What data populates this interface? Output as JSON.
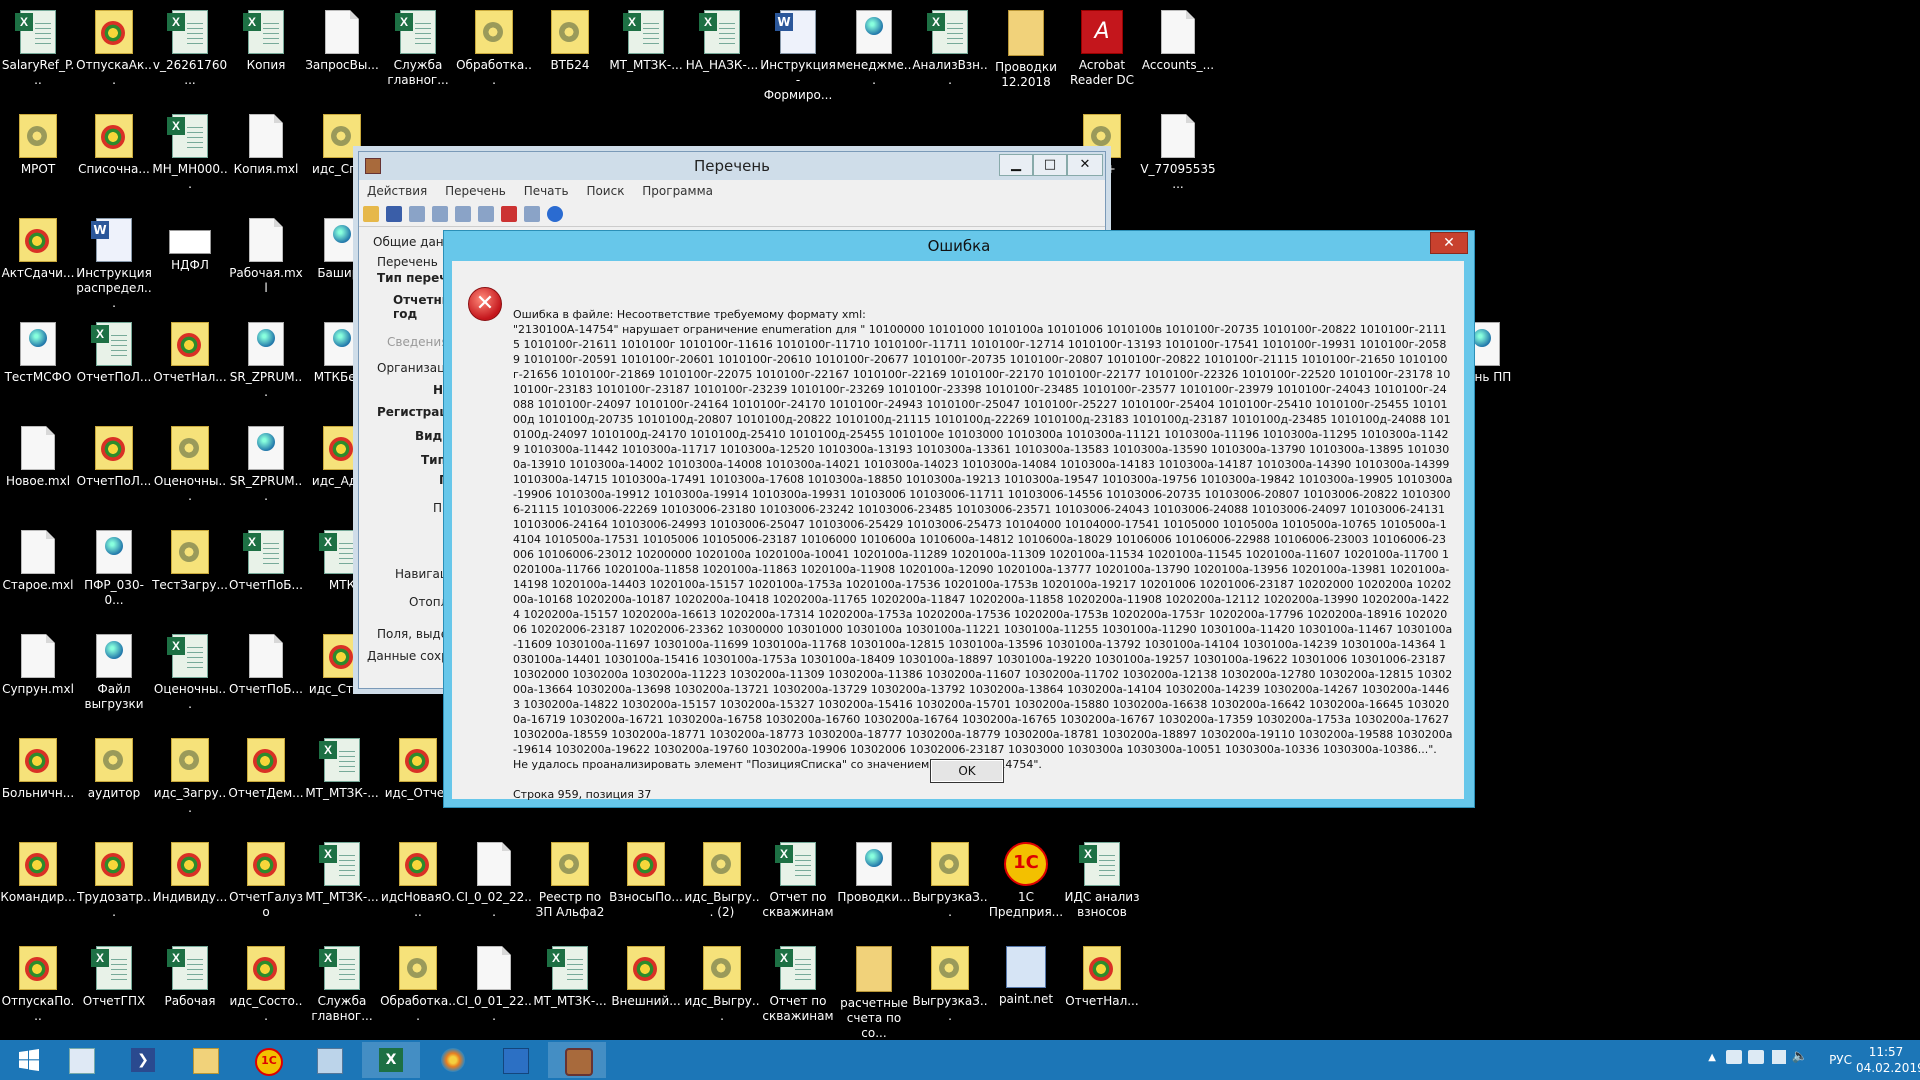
{
  "desktop": {
    "icons": [
      {
        "label": "SalaryRef_P...",
        "icon": "doc-icon",
        "t": "xls",
        "col": 0,
        "row": 0
      },
      {
        "label": "ОтпускаАк...",
        "icon": "1c-icon",
        "t": "1c",
        "col": 1,
        "row": 0
      },
      {
        "label": "v_26261760...",
        "icon": "excel-icon",
        "t": "xls",
        "col": 2,
        "row": 0
      },
      {
        "label": "Копия",
        "icon": "excel-icon",
        "t": "xls",
        "col": 3,
        "row": 0
      },
      {
        "label": "ЗапросВы...",
        "icon": "file-icon",
        "t": "doc",
        "col": 4,
        "row": 0
      },
      {
        "label": "Служба главног...",
        "icon": "excel-icon",
        "t": "xls",
        "col": 5,
        "row": 0
      },
      {
        "label": "Обработка...",
        "icon": "gear-file-icon",
        "t": "gear",
        "col": 6,
        "row": 0
      },
      {
        "label": "ВТБ24",
        "icon": "gear-file-icon",
        "t": "gear",
        "col": 7,
        "row": 0
      },
      {
        "label": "МТ_МТЗК-...",
        "icon": "excel-icon",
        "t": "xls",
        "col": 8,
        "row": 0
      },
      {
        "label": "НА_НАЗК-...",
        "icon": "excel-icon",
        "t": "xls",
        "col": 9,
        "row": 0
      },
      {
        "label": "Инструкция - Формиро...",
        "icon": "word-icon",
        "t": "word",
        "col": 10,
        "row": 0
      },
      {
        "label": "менеджме...",
        "icon": "web-file-icon",
        "t": "web",
        "col": 11,
        "row": 0
      },
      {
        "label": "АнализВзн...",
        "icon": "excel-icon",
        "t": "xls",
        "col": 12,
        "row": 0
      },
      {
        "label": "Проводки 12.2018",
        "icon": "folder-icon",
        "t": "folder",
        "col": 13,
        "row": 0
      },
      {
        "label": "Acrobat Reader DC",
        "icon": "acrobat-icon",
        "t": "pdf",
        "col": 14,
        "row": 0
      },
      {
        "label": "Accounts_...",
        "icon": "file-icon",
        "t": "doc",
        "col": 15,
        "row": 0
      },
      {
        "label": "МРОТ",
        "icon": "gear-file-icon",
        "t": "gear",
        "col": 0,
        "row": 1
      },
      {
        "label": "Списочна...",
        "icon": "1c-icon",
        "t": "1c",
        "col": 1,
        "row": 1
      },
      {
        "label": "МН_МН000...",
        "icon": "excel-icon",
        "t": "xls",
        "col": 2,
        "row": 1
      },
      {
        "label": "Копия.mxl",
        "icon": "file-icon",
        "t": "doc",
        "col": 3,
        "row": 1
      },
      {
        "label": "идс_Спра",
        "icon": "gear-file-icon",
        "t": "gear",
        "col": 4,
        "row": 1
      },
      {
        "label": "d++",
        "icon": "notepad-icon",
        "t": "gear",
        "col": 14,
        "row": 1
      },
      {
        "label": "V_77095535...",
        "icon": "file-icon",
        "t": "doc",
        "col": 15,
        "row": 1
      },
      {
        "label": "АктСдачи...",
        "icon": "1c-icon",
        "t": "1c",
        "col": 0,
        "row": 2
      },
      {
        "label": "Инструкция распредел...",
        "icon": "word-icon",
        "t": "word",
        "col": 1,
        "row": 2
      },
      {
        "label": "НДФЛ",
        "icon": "ndfl-icon",
        "t": "ndfl",
        "col": 2,
        "row": 2
      },
      {
        "label": "Рабочая.mxl",
        "icon": "file-icon",
        "t": "doc",
        "col": 3,
        "row": 2
      },
      {
        "label": "Баширо",
        "icon": "web-file-icon",
        "t": "web",
        "col": 4,
        "row": 2
      },
      {
        "label": "ТестМСФО",
        "icon": "web-file-icon",
        "t": "web",
        "col": 0,
        "row": 3
      },
      {
        "label": "ОтчетПоЛ...",
        "icon": "excel-icon",
        "t": "xls",
        "col": 1,
        "row": 3
      },
      {
        "label": "ОтчетНал...",
        "icon": "1c-icon",
        "t": "1c",
        "col": 2,
        "row": 3
      },
      {
        "label": "SR_ZPRUM...",
        "icon": "web-file-icon",
        "t": "web",
        "col": 3,
        "row": 3
      },
      {
        "label": "МТКБезА",
        "icon": "web-file-icon",
        "t": "web",
        "col": 4,
        "row": 3
      },
      {
        "label": "ечень ПП",
        "icon": "web-file-icon",
        "t": "web",
        "col": 19,
        "row": 3
      },
      {
        "label": "Новое.mxl",
        "icon": "file-icon",
        "t": "doc",
        "col": 0,
        "row": 4
      },
      {
        "label": "ОтчетПоЛ...",
        "icon": "1c-icon",
        "t": "1c",
        "col": 1,
        "row": 4
      },
      {
        "label": "Оценочны...",
        "icon": "gear-file-icon",
        "t": "gear",
        "col": 2,
        "row": 4
      },
      {
        "label": "SR_ZPRUM...",
        "icon": "web-file-icon",
        "t": "web",
        "col": 3,
        "row": 4
      },
      {
        "label": "идс_Адре",
        "icon": "1c-icon",
        "t": "1c",
        "col": 4,
        "row": 4
      },
      {
        "label": "Старое.mxl",
        "icon": "file-icon",
        "t": "doc",
        "col": 0,
        "row": 5
      },
      {
        "label": "ПФР_030-0...",
        "icon": "web-file-icon",
        "t": "web",
        "col": 1,
        "row": 5
      },
      {
        "label": "ТестЗагру...",
        "icon": "gear-file-icon",
        "t": "gear",
        "col": 2,
        "row": 5
      },
      {
        "label": "ОтчетПоБ...",
        "icon": "excel-icon",
        "t": "xls",
        "col": 3,
        "row": 5
      },
      {
        "label": "МТК",
        "icon": "excel-icon",
        "t": "xls",
        "col": 4,
        "row": 5
      },
      {
        "label": "Супрун.mxl",
        "icon": "file-icon",
        "t": "doc",
        "col": 0,
        "row": 6
      },
      {
        "label": "Файл выгрузки",
        "icon": "web-file-icon",
        "t": "web",
        "col": 1,
        "row": 6
      },
      {
        "label": "Оценочны...",
        "icon": "excel-icon",
        "t": "xls",
        "col": 2,
        "row": 6
      },
      {
        "label": "ОтчетПоБ...",
        "icon": "file-icon",
        "t": "doc",
        "col": 3,
        "row": 6
      },
      {
        "label": "идс_Стати",
        "icon": "1c-icon",
        "t": "1c",
        "col": 4,
        "row": 6
      },
      {
        "label": "Больничн...",
        "icon": "1c-icon",
        "t": "1c",
        "col": 0,
        "row": 7
      },
      {
        "label": "аудитор",
        "icon": "gear-file-icon",
        "t": "gear",
        "col": 1,
        "row": 7
      },
      {
        "label": "идс_Загру...",
        "icon": "gear-file-icon",
        "t": "gear",
        "col": 2,
        "row": 7
      },
      {
        "label": "ОтчетДем...",
        "icon": "1c-icon",
        "t": "1c",
        "col": 3,
        "row": 7
      },
      {
        "label": "МТ_МТЗК-...",
        "icon": "excel-icon",
        "t": "xls",
        "col": 4,
        "row": 7
      },
      {
        "label": "идс_Отчет",
        "icon": "1c-icon",
        "t": "1c",
        "col": 5,
        "row": 7
      },
      {
        "label": "Командир...",
        "icon": "1c-icon",
        "t": "1c",
        "col": 0,
        "row": 8
      },
      {
        "label": "Трудозатр...",
        "icon": "1c-icon",
        "t": "1c",
        "col": 1,
        "row": 8
      },
      {
        "label": "Индивиду...",
        "icon": "1c-icon",
        "t": "1c",
        "col": 2,
        "row": 8
      },
      {
        "label": "ОтчетГалузо",
        "icon": "1c-icon",
        "t": "1c",
        "col": 3,
        "row": 8
      },
      {
        "label": "МТ_МТЗК-...",
        "icon": "excel-icon",
        "t": "xls",
        "col": 4,
        "row": 8
      },
      {
        "label": "идсНоваяО...",
        "icon": "1c-icon",
        "t": "1c",
        "col": 5,
        "row": 8
      },
      {
        "label": "CI_0_02_22...",
        "icon": "file-icon",
        "t": "doc",
        "col": 6,
        "row": 8
      },
      {
        "label": "Реестр по ЗП Альфа2",
        "icon": "gear-file-icon",
        "t": "gear",
        "col": 7,
        "row": 8
      },
      {
        "label": "ВзносыПо...",
        "icon": "1c-icon",
        "t": "1c",
        "col": 8,
        "row": 8
      },
      {
        "label": "идс_Выгру... (2)",
        "icon": "gear-file-icon",
        "t": "gear",
        "col": 9,
        "row": 8
      },
      {
        "label": "Отчет по скважинам",
        "icon": "excel-icon",
        "t": "xls",
        "col": 10,
        "row": 8
      },
      {
        "label": "Проводки...",
        "icon": "web-file-icon",
        "t": "web",
        "col": 11,
        "row": 8
      },
      {
        "label": "ВыгрузкаЗ...",
        "icon": "gear-file-icon",
        "t": "gear",
        "col": 12,
        "row": 8
      },
      {
        "label": "1С Предприя...",
        "icon": "1c-enterprise-icon",
        "t": "1cp",
        "col": 13,
        "row": 8
      },
      {
        "label": "ИДС анализ взносов",
        "icon": "excel-icon",
        "t": "xls",
        "col": 14,
        "row": 8
      },
      {
        "label": "ОтпускаПо...",
        "icon": "1c-icon",
        "t": "1c",
        "col": 0,
        "row": 9
      },
      {
        "label": "ОтчетГПХ",
        "icon": "excel-icon",
        "t": "xls",
        "col": 1,
        "row": 9
      },
      {
        "label": "Рабочая",
        "icon": "excel-icon",
        "t": "xls",
        "col": 2,
        "row": 9
      },
      {
        "label": "идс_Состо...",
        "icon": "1c-icon",
        "t": "1c",
        "col": 3,
        "row": 9
      },
      {
        "label": "Служба главног...",
        "icon": "excel-icon",
        "t": "xls",
        "col": 4,
        "row": 9
      },
      {
        "label": "Обработка...",
        "icon": "gear-file-icon",
        "t": "gear",
        "col": 5,
        "row": 9
      },
      {
        "label": "CI_0_01_22...",
        "icon": "file-icon",
        "t": "doc",
        "col": 6,
        "row": 9
      },
      {
        "label": "МТ_МТЗК-...",
        "icon": "excel-icon",
        "t": "xls",
        "col": 7,
        "row": 9
      },
      {
        "label": "Внешний...",
        "icon": "1c-icon",
        "t": "1c",
        "col": 8,
        "row": 9
      },
      {
        "label": "идс_Выгру...",
        "icon": "gear-file-icon",
        "t": "gear",
        "col": 9,
        "row": 9
      },
      {
        "label": "Отчет по скважинам",
        "icon": "excel-icon",
        "t": "xls",
        "col": 10,
        "row": 9
      },
      {
        "label": "расчетные счета по со...",
        "icon": "folder-icon",
        "t": "folder",
        "col": 11,
        "row": 9
      },
      {
        "label": "ВыгрузкаЗ...",
        "icon": "gear-file-icon",
        "t": "gear",
        "col": 12,
        "row": 9
      },
      {
        "label": "paint.net",
        "icon": "paint-icon",
        "t": "paint",
        "col": 13,
        "row": 9
      },
      {
        "label": "ОтчетНал...",
        "icon": "1c-icon",
        "t": "1c",
        "col": 14,
        "row": 9
      }
    ]
  },
  "perechen_window": {
    "title": "Перечень",
    "menu": [
      "Действия",
      "Перечень",
      "Печать",
      "Поиск",
      "Программа"
    ],
    "labels": {
      "general_tab": "Общие данны",
      "perechen": "Перечень",
      "type": "Тип перечн",
      "period": "Отчетны",
      "year": "год",
      "info": "Сведения о",
      "org": "Организаци",
      "n": "Н",
      "reg": "Регистраци",
      "kind": "Вид д",
      "tip": "Тип",
      "p1": "П",
      "pr": "Пр",
      "nav": "Навигаци",
      "opl": "Отоплi",
      "fields": "Поля, выделе",
      "saved": "Данные сохран"
    }
  },
  "error_dialog": {
    "title": "Ошибка",
    "close": "✕",
    "message": "Ошибка в файле: Несоответствие требуемому формату xml:\n\"2130100А-14754\" нарушает ограничение enumeration для \" 10100000 10101000 1010100а 10101006 1010100в 1010100г-20735 1010100г-20822 1010100г-21115 1010100г-21611 1010100г 1010100г-11616 1010100г-11710 1010100г-11711 1010100г-12714 1010100г-13193 1010100г-17541 1010100г-19931 1010100г-20589 1010100г-20591 1010100г-20601 1010100г-20610 1010100г-20677 1010100г-20735 1010100г-20807 1010100г-20822 1010100г-21115 1010100г-21650 1010100г-21656 1010100г-21869 1010100г-22075 1010100г-22167 1010100г-22169 1010100г-22170 1010100г-22177 1010100г-22326 1010100г-22520 1010100г-23178 1010100г-23183 1010100г-23187 1010100г-23239 1010100г-23269 1010100г-23398 1010100г-23485 1010100г-23577 1010100г-23979 1010100г-24043 1010100г-24088 1010100г-24097 1010100г-24164 1010100г-24170 1010100г-24943 1010100г-25047 1010100г-25227 1010100г-25404 1010100г-25410 1010100г-25455 1010100д 1010100д-20735 1010100д-20807 1010100д-20822 1010100д-21115 1010100д-22269 1010100д-23183 1010100д-23187 1010100д-23485 1010100д-24088 1010100д-24097 1010100д-24170 1010100д-25410 1010100д-25455 1010100е 10103000 1010300а 1010300а-11121 1010300а-11196 1010300а-11295 1010300а-11429 1010300а-11442 1010300а-11717 1010300а-12520 1010300а-13193 1010300а-13361 1010300а-13583 1010300а-13590 1010300а-13790 1010300а-13895 1010300а-13910 1010300а-14002 1010300а-14008 1010300а-14021 1010300а-14023 1010300а-14084 1010300а-14183 1010300а-14187 1010300а-14390 1010300а-14399 1010300а-14715 1010300а-17491 1010300а-17608 1010300а-18850 1010300а-19213 1010300а-19547 1010300а-19756 1010300а-19842 1010300а-19905 1010300а-19906 1010300а-19912 1010300а-19914 1010300а-19931 1010300б 10103006-11711 10103006-14556 10103006-20735 10103006-20807 10103006-20822 10103006-21115 10103006-22269 10103006-23180 10103006-23242 10103006-23485 10103006-23571 10103006-24043 10103006-24088 10103006-24097 10103006-24131 10103006-24164 10103006-24993 10103006-25047 10103006-25429 10103006-25473 10104000 10104000-17541 10105000 1010500а 1010500а-10765 1010500а-14104 1010500а-17531 10105006 10105006-23187 10106000 1010600а 1010600а-14812 1010600а-18029 10106006 10106006-22988 10106006-23003 10106006-23006 10106006-23012 10200000 1020100а 1020100а-10041 1020100а-11289 1020100а-11309 1020100а-11534 1020100а-11545 1020100а-11607 1020100а-11700 1020100а-11766 1020100а-11858 1020100а-11863 1020100а-11908 1020100а-12090 1020100а-13777 1020100а-13790 1020100а-13956 1020100а-13981 1020100а-14198 1020100а-14403 1020100а-15157 1020100а-1753а 1020100а-17536 1020100а-1753в 1020100а-19217 10201006 10201006-23187 10202000 1020200а 1020200а-10168 1020200а-10187 1020200а-10418 1020200а-11765 1020200а-11847 1020200а-11858 1020200а-11908 1020200а-12112 1020200а-13990 1020200а-14224 1020200а-15157 1020200а-16613 1020200а-17314 1020200а-1753а 1020200а-17536 1020200а-1753в 1020200а-1753г 1020200а-17796 1020200а-18916 10202006 10202006-23187 10202006-23362 10300000 10301000 1030100а 1030100а-11221 1030100а-11255 1030100а-11290 1030100а-11420 1030100а-11467 1030100а-11609 1030100а-11697 1030100а-11699 1030100а-11768 1030100а-12815 1030100а-13596 1030100а-13792 1030100а-14104 1030100а-14239 1030100а-14364 1030100а-14401 1030100а-15416 1030100а-1753а 1030100а-18409 1030100а-18897 1030100а-19220 1030100а-19257 1030100а-19622 10301006 10301006-23187 10302000 1030200а 1030200а-11223 1030200а-11309 1030200а-11386 1030200а-11607 1030200а-11702 1030200а-12138 1030200а-12780 1030200а-12815 1030200а-13664 1030200а-13698 1030200а-13721 1030200а-13729 1030200а-13792 1030200а-13864 1030200а-14104 1030200а-14239 1030200а-14267 1030200а-14463 1030200а-14822 1030200а-15157 1030200а-15327 1030200а-15416 1030200а-15701 1030200а-15880 1030200а-16638 1030200а-16642 1030200а-16645 1030200а-16719 1030200а-16721 1030200а-16758 1030200а-16760 1030200а-16764 1030200а-16765 1030200а-16767 1030200а-17359 1030200а-1753а 1030200а-17627 1030200а-18559 1030200а-18771 1030200а-18773 1030200а-18777 1030200а-18779 1030200а-18781 1030200а-18897 1030200а-19110 1030200а-19588 1030200а-19614 1030200а-19622 1030200а-19760 1030200а-19906 10302006 10302006-23187 10303000 1030300а 1030300а-10051 1030300а-10336 1030300а-10386...\".\nНе удалось проанализировать элемент \"ПозицияСписка\" со значением \"2130100А-14754\".\n\nСтрока 959, позиция 37",
    "ok": "OK"
  },
  "taskbar": {
    "apps": [
      "start",
      "server-manager",
      "powershell",
      "explorer",
      "1c",
      "notepad",
      "excel",
      "paint",
      "remote-desktop",
      "perechen"
    ],
    "lang": "РУС",
    "time": "11:57",
    "date": "04.02.2019"
  },
  "colors": {
    "desktop": "#000000",
    "taskbar": "#1c76b7",
    "dialog_frame": "#67c7ea",
    "close_red": "#c8412e"
  }
}
